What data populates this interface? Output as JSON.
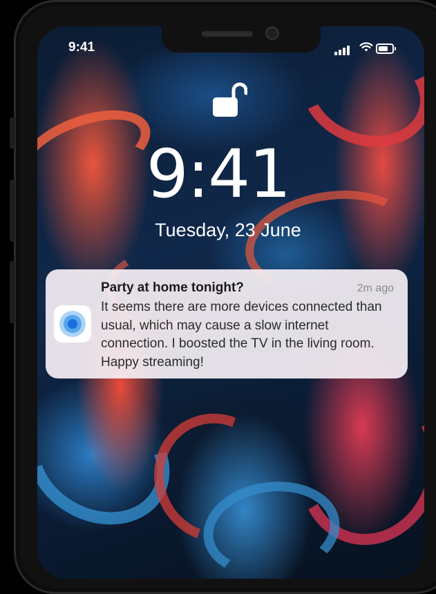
{
  "status_bar": {
    "time": "9:41"
  },
  "lock_screen": {
    "time": "9:41",
    "date": "Tuesday,  23 June"
  },
  "notification": {
    "app_icon": "radar-signal-icon",
    "title": "Party at home tonight?",
    "timestamp": "2m ago",
    "body": "It seems there are more devices connected than usual, which may cause a slow internet connection. I boosted the TV in the living room. Happy streaming!"
  },
  "icons": {
    "lock": "unlocked-padlock-icon",
    "signal": "cellular-signal-icon",
    "wifi": "wifi-icon",
    "battery": "battery-icon"
  },
  "colors": {
    "accent_blue": "#1a6ede",
    "notification_bg": "#f4eef3"
  }
}
